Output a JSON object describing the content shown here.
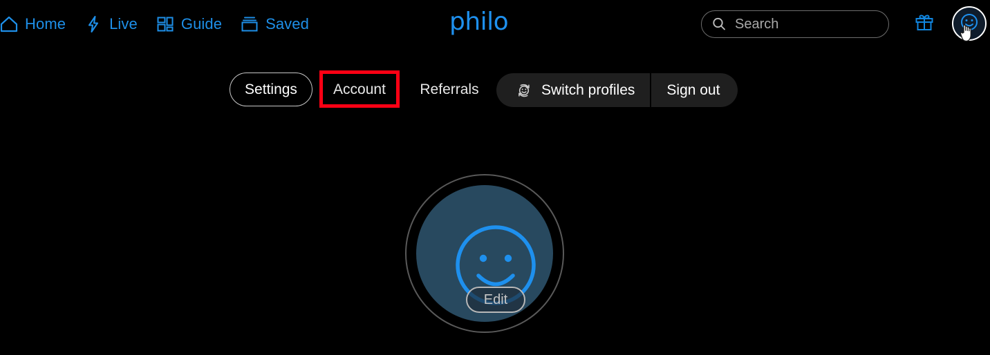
{
  "theme": {
    "background": "#000000",
    "accent_blue": "#1e8fe8",
    "logo_blue": "#1e90ee",
    "highlight_red": "#ff0014",
    "avatar_fill": "#28495f",
    "pill_gray": "#1f1f1f",
    "border_gray": "#6e6e6e"
  },
  "header": {
    "nav": [
      {
        "label": "Home",
        "icon": "home-icon"
      },
      {
        "label": "Live",
        "icon": "lightning-bolt-icon"
      },
      {
        "label": "Guide",
        "icon": "grid-icon"
      },
      {
        "label": "Saved",
        "icon": "saved-box-icon"
      }
    ],
    "logo": "philo",
    "search": {
      "placeholder": "Search",
      "value": "",
      "icon": "search-icon"
    },
    "gift_icon": "gift-icon",
    "avatar_icon": "smiley-face-icon",
    "cursor": "hand-pointer-cursor"
  },
  "tabs": {
    "settings": "Settings",
    "account": "Account",
    "referrals": "Referrals",
    "switch_profiles": "Switch profiles",
    "switch_profiles_icon": "switch-profiles-smiley-icon",
    "sign_out": "Sign out"
  },
  "profile": {
    "avatar_icon": "smiley-face-icon",
    "edit_label": "Edit"
  }
}
